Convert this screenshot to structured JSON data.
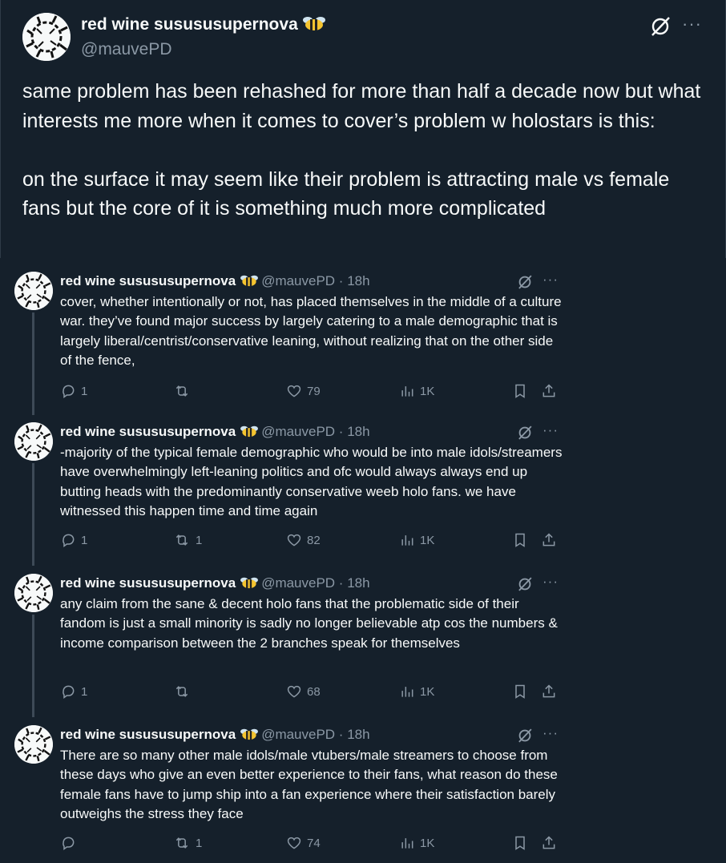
{
  "main": {
    "name": "red wine susususupernova",
    "handle": "@mauvePD",
    "text": "same problem has been rehashed for more than half a decade now but what interests me more when it comes to cover’s problem w holostars is this:\n\non the surface it may seem like their problem is attracting male vs female fans but the core of it is something much more complicated"
  },
  "replies": [
    {
      "name": "red wine susususupernova",
      "handle": "@mauvePD · 18h",
      "text": "cover, whether intentionally or not, has placed themselves in the middle of a culture war. they’ve found major success by largely catering to a male demographic that is largely liberal/centrist/conservative leaning, without realizing that on the other side of the fence,",
      "replies": "1",
      "reposts": "",
      "likes": "79",
      "views": "1K"
    },
    {
      "name": "red wine susususupernova",
      "handle": "@mauvePD · 18h",
      "text": "-majority of the typical female demographic who would be into male idols/streamers have overwhelmingly left-leaning politics and ofc would always always end up butting heads with the predominantly conservative weeb holo fans. we have witnessed this happen time and time again",
      "replies": "1",
      "reposts": "1",
      "likes": "82",
      "views": "1K"
    },
    {
      "name": "red wine susususupernova",
      "handle": "@mauvePD · 18h",
      "text": "any claim from the sane & decent holo fans that the problematic side of their fandom is just a small minority is sadly no longer believable atp cos the numbers & income comparison between the 2 branches speak for themselves",
      "replies": "1",
      "reposts": "",
      "likes": "68",
      "views": "1K"
    },
    {
      "name": "red wine susususupernova",
      "handle": "@mauvePD · 18h",
      "text": "There are so many other male idols/male vtubers/male streamers to choose from these days who give an even better experience to their fans, what reason do these female fans have to jump ship into a fan experience where their satisfaction barely outweighs the stress they face",
      "replies": "",
      "reposts": "1",
      "likes": "74",
      "views": "1K"
    }
  ],
  "more_glyph": "···",
  "colors": {
    "background": "#15202b",
    "text": "#f7f9f9",
    "muted": "#8b98a5",
    "thread_line": "#3d4a57"
  },
  "icons": [
    "grok-icon",
    "more-icon",
    "reply-icon",
    "repost-icon",
    "like-icon",
    "views-icon",
    "bookmark-icon",
    "share-icon",
    "bee-emoji-icon"
  ]
}
